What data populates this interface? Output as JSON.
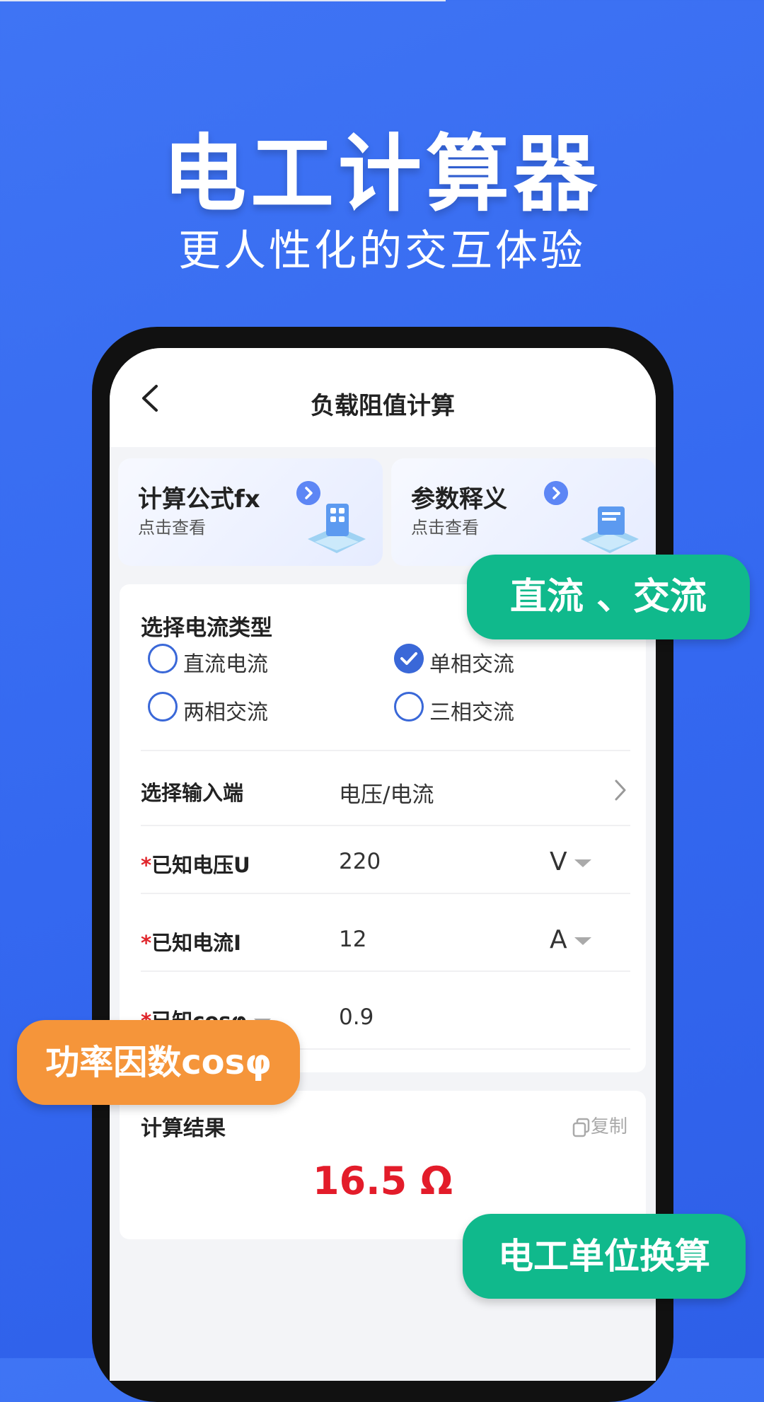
{
  "promo": {
    "title": "电工计算器",
    "subtitle": "更人性化的交互体验"
  },
  "nav": {
    "title": "负载阻值计算",
    "back_icon": "chevron-left-icon"
  },
  "cards": [
    {
      "title": "计算公式fx",
      "sub": "点击查看",
      "icon": "chevron-right-icon"
    },
    {
      "title": "参数释义",
      "sub": "点击查看",
      "icon": "chevron-right-icon"
    }
  ],
  "form": {
    "current_type_label": "选择电流类型",
    "options": [
      {
        "label": "直流电流",
        "selected": false
      },
      {
        "label": "单相交流",
        "selected": true
      },
      {
        "label": "两相交流",
        "selected": false
      },
      {
        "label": "三相交流",
        "selected": false
      }
    ],
    "input_side_label": "选择输入端",
    "input_side_value": "电压/电流",
    "fields": [
      {
        "star": "*",
        "label": "已知电压U",
        "value": "220",
        "unit": "V"
      },
      {
        "star": "*",
        "label": "已知电流I",
        "value": "12",
        "unit": "A"
      },
      {
        "star": "*",
        "label": "已知cosφ",
        "value": "0.9"
      }
    ]
  },
  "result": {
    "title": "计算结果",
    "copy_label": "复制",
    "value": "16.5 Ω"
  },
  "tags": {
    "tag1": "直流 、交流",
    "tag2": "功率因数cosφ",
    "tag3": "电工单位换算"
  },
  "colors": {
    "background": "#3468f0",
    "accent": "#3a68d8",
    "result": "#e31c2a",
    "green_tag": "#10b98c",
    "orange_tag": "#f5953a"
  }
}
